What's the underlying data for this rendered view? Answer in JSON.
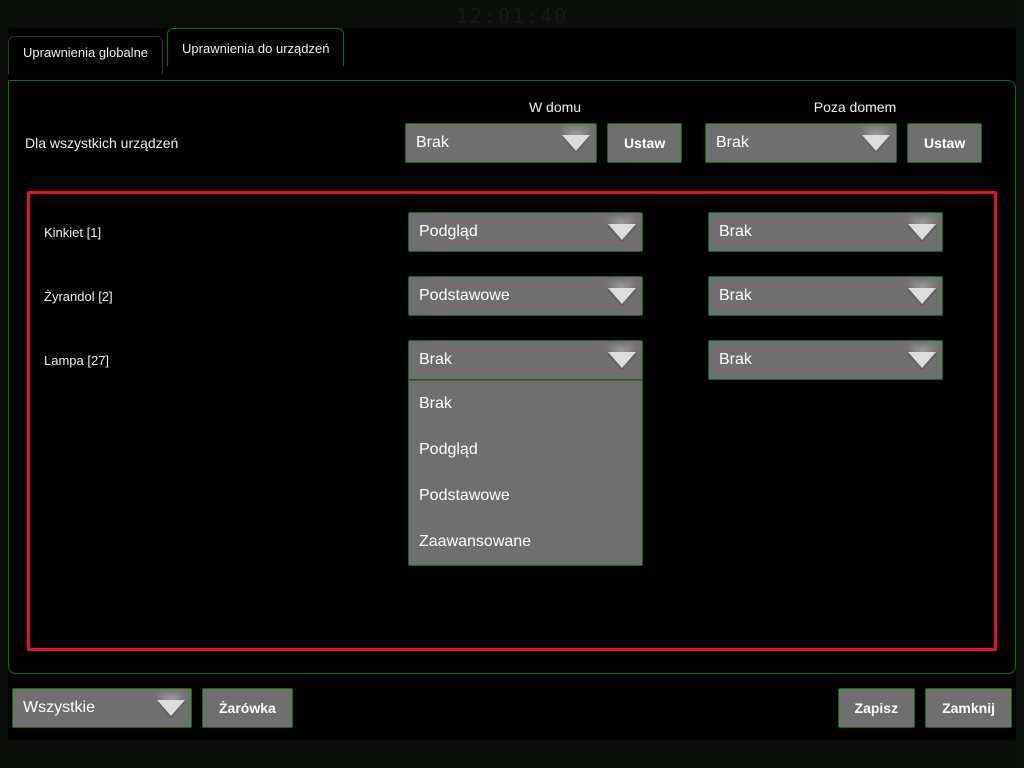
{
  "clock": "12:01:40",
  "tabs": {
    "global": "Uprawnienia globalne",
    "devices": "Uprawnienia do urządzeń"
  },
  "columns": {
    "home": "W domu",
    "away": "Poza domem"
  },
  "allDevices": {
    "label": "Dla wszystkich urządzeń",
    "home_value": "Brak",
    "away_value": "Brak",
    "set_button": "Ustaw"
  },
  "devices": [
    {
      "label": "Kinkiet [1]",
      "home": "Podgląd",
      "away": "Brak"
    },
    {
      "label": "Żyrandol [2]",
      "home": "Podstawowe",
      "away": "Brak"
    },
    {
      "label": "Lampa [27]",
      "home": "Brak",
      "away": "Brak"
    }
  ],
  "dropdown_options": [
    "Brak",
    "Podgląd",
    "Podstawowe",
    "Zaawansowane"
  ],
  "footer": {
    "filter_value": "Wszystkie",
    "device_type": "Żarówka",
    "save": "Zapisz",
    "close": "Zamknij"
  }
}
